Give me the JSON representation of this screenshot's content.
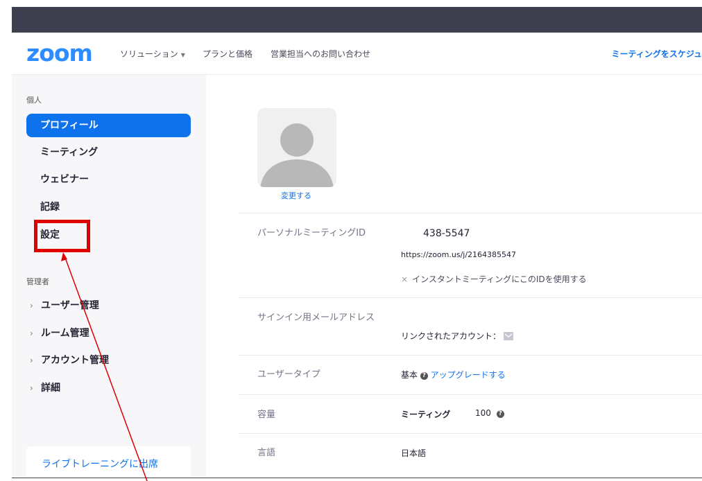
{
  "header": {
    "logo": "zoom",
    "nav": [
      "ソリューション",
      "プランと価格",
      "営業担当へのお問い合わせ"
    ],
    "schedule": "ミーティングをスケジュ"
  },
  "sidebar": {
    "personal_label": "個人",
    "personal_items": [
      "プロフィール",
      "ミーティング",
      "ウェビナー",
      "記録",
      "設定"
    ],
    "admin_label": "管理者",
    "admin_items": [
      "ユーザー管理",
      "ルーム管理",
      "アカウント管理",
      "詳細"
    ],
    "live_training": "ライブトレーニングに出席"
  },
  "profile": {
    "change_label": "変更する",
    "pmi_label": "パーソナルミーティングID",
    "pmi_value": "438-5547",
    "pmi_url": "https://zoom.us/j/2164385547",
    "pmi_mark": "×",
    "pmi_instant": "インスタントミーティングにこのIDを使用する",
    "email_label": "サインイン用メールアドレス",
    "linked_account": "リンクされたアカウント：",
    "user_type_label": "ユーザータイプ",
    "user_type_value": "基本",
    "upgrade": "アップグレードする",
    "capacity_label": "容量",
    "capacity_meeting": "ミーティング",
    "capacity_value": "100",
    "language_label": "言語",
    "language_value": "日本語"
  },
  "colors": {
    "accent": "#0e72ed",
    "topbar": "#3d3e4e",
    "highlight": "#e00000",
    "arrow": "#e00000"
  }
}
